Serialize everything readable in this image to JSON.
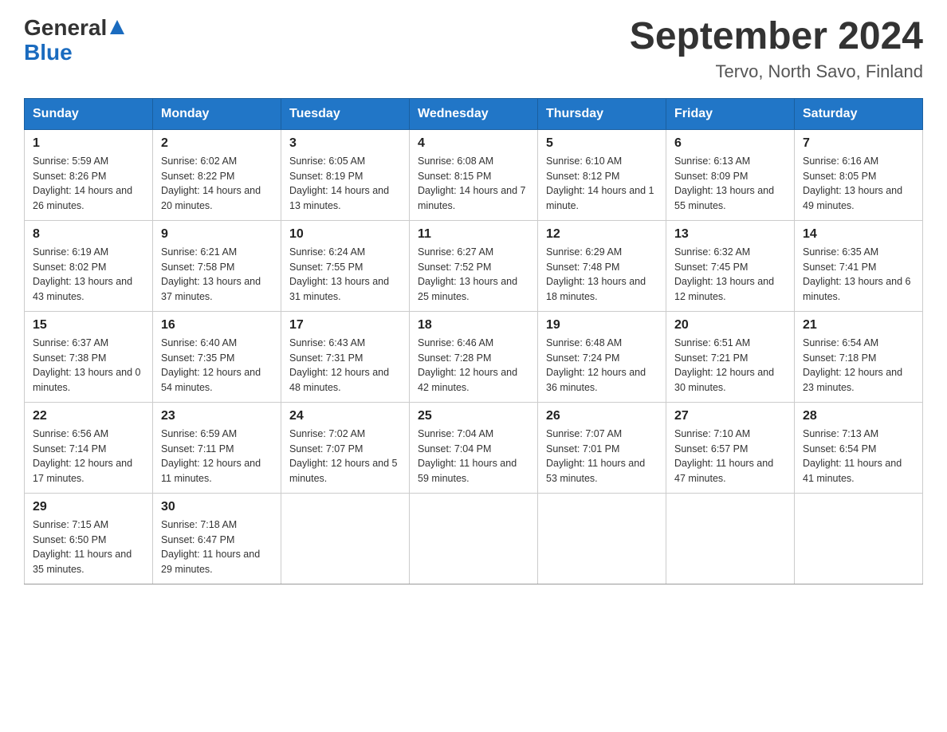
{
  "header": {
    "logo_general": "General",
    "logo_blue": "Blue",
    "month_year": "September 2024",
    "location": "Tervo, North Savo, Finland"
  },
  "weekdays": [
    "Sunday",
    "Monday",
    "Tuesday",
    "Wednesday",
    "Thursday",
    "Friday",
    "Saturday"
  ],
  "weeks": [
    [
      {
        "day": "1",
        "sunrise": "5:59 AM",
        "sunset": "8:26 PM",
        "daylight": "14 hours and 26 minutes."
      },
      {
        "day": "2",
        "sunrise": "6:02 AM",
        "sunset": "8:22 PM",
        "daylight": "14 hours and 20 minutes."
      },
      {
        "day": "3",
        "sunrise": "6:05 AM",
        "sunset": "8:19 PM",
        "daylight": "14 hours and 13 minutes."
      },
      {
        "day": "4",
        "sunrise": "6:08 AM",
        "sunset": "8:15 PM",
        "daylight": "14 hours and 7 minutes."
      },
      {
        "day": "5",
        "sunrise": "6:10 AM",
        "sunset": "8:12 PM",
        "daylight": "14 hours and 1 minute."
      },
      {
        "day": "6",
        "sunrise": "6:13 AM",
        "sunset": "8:09 PM",
        "daylight": "13 hours and 55 minutes."
      },
      {
        "day": "7",
        "sunrise": "6:16 AM",
        "sunset": "8:05 PM",
        "daylight": "13 hours and 49 minutes."
      }
    ],
    [
      {
        "day": "8",
        "sunrise": "6:19 AM",
        "sunset": "8:02 PM",
        "daylight": "13 hours and 43 minutes."
      },
      {
        "day": "9",
        "sunrise": "6:21 AM",
        "sunset": "7:58 PM",
        "daylight": "13 hours and 37 minutes."
      },
      {
        "day": "10",
        "sunrise": "6:24 AM",
        "sunset": "7:55 PM",
        "daylight": "13 hours and 31 minutes."
      },
      {
        "day": "11",
        "sunrise": "6:27 AM",
        "sunset": "7:52 PM",
        "daylight": "13 hours and 25 minutes."
      },
      {
        "day": "12",
        "sunrise": "6:29 AM",
        "sunset": "7:48 PM",
        "daylight": "13 hours and 18 minutes."
      },
      {
        "day": "13",
        "sunrise": "6:32 AM",
        "sunset": "7:45 PM",
        "daylight": "13 hours and 12 minutes."
      },
      {
        "day": "14",
        "sunrise": "6:35 AM",
        "sunset": "7:41 PM",
        "daylight": "13 hours and 6 minutes."
      }
    ],
    [
      {
        "day": "15",
        "sunrise": "6:37 AM",
        "sunset": "7:38 PM",
        "daylight": "13 hours and 0 minutes."
      },
      {
        "day": "16",
        "sunrise": "6:40 AM",
        "sunset": "7:35 PM",
        "daylight": "12 hours and 54 minutes."
      },
      {
        "day": "17",
        "sunrise": "6:43 AM",
        "sunset": "7:31 PM",
        "daylight": "12 hours and 48 minutes."
      },
      {
        "day": "18",
        "sunrise": "6:46 AM",
        "sunset": "7:28 PM",
        "daylight": "12 hours and 42 minutes."
      },
      {
        "day": "19",
        "sunrise": "6:48 AM",
        "sunset": "7:24 PM",
        "daylight": "12 hours and 36 minutes."
      },
      {
        "day": "20",
        "sunrise": "6:51 AM",
        "sunset": "7:21 PM",
        "daylight": "12 hours and 30 minutes."
      },
      {
        "day": "21",
        "sunrise": "6:54 AM",
        "sunset": "7:18 PM",
        "daylight": "12 hours and 23 minutes."
      }
    ],
    [
      {
        "day": "22",
        "sunrise": "6:56 AM",
        "sunset": "7:14 PM",
        "daylight": "12 hours and 17 minutes."
      },
      {
        "day": "23",
        "sunrise": "6:59 AM",
        "sunset": "7:11 PM",
        "daylight": "12 hours and 11 minutes."
      },
      {
        "day": "24",
        "sunrise": "7:02 AM",
        "sunset": "7:07 PM",
        "daylight": "12 hours and 5 minutes."
      },
      {
        "day": "25",
        "sunrise": "7:04 AM",
        "sunset": "7:04 PM",
        "daylight": "11 hours and 59 minutes."
      },
      {
        "day": "26",
        "sunrise": "7:07 AM",
        "sunset": "7:01 PM",
        "daylight": "11 hours and 53 minutes."
      },
      {
        "day": "27",
        "sunrise": "7:10 AM",
        "sunset": "6:57 PM",
        "daylight": "11 hours and 47 minutes."
      },
      {
        "day": "28",
        "sunrise": "7:13 AM",
        "sunset": "6:54 PM",
        "daylight": "11 hours and 41 minutes."
      }
    ],
    [
      {
        "day": "29",
        "sunrise": "7:15 AM",
        "sunset": "6:50 PM",
        "daylight": "11 hours and 35 minutes."
      },
      {
        "day": "30",
        "sunrise": "7:18 AM",
        "sunset": "6:47 PM",
        "daylight": "11 hours and 29 minutes."
      },
      null,
      null,
      null,
      null,
      null
    ]
  ]
}
